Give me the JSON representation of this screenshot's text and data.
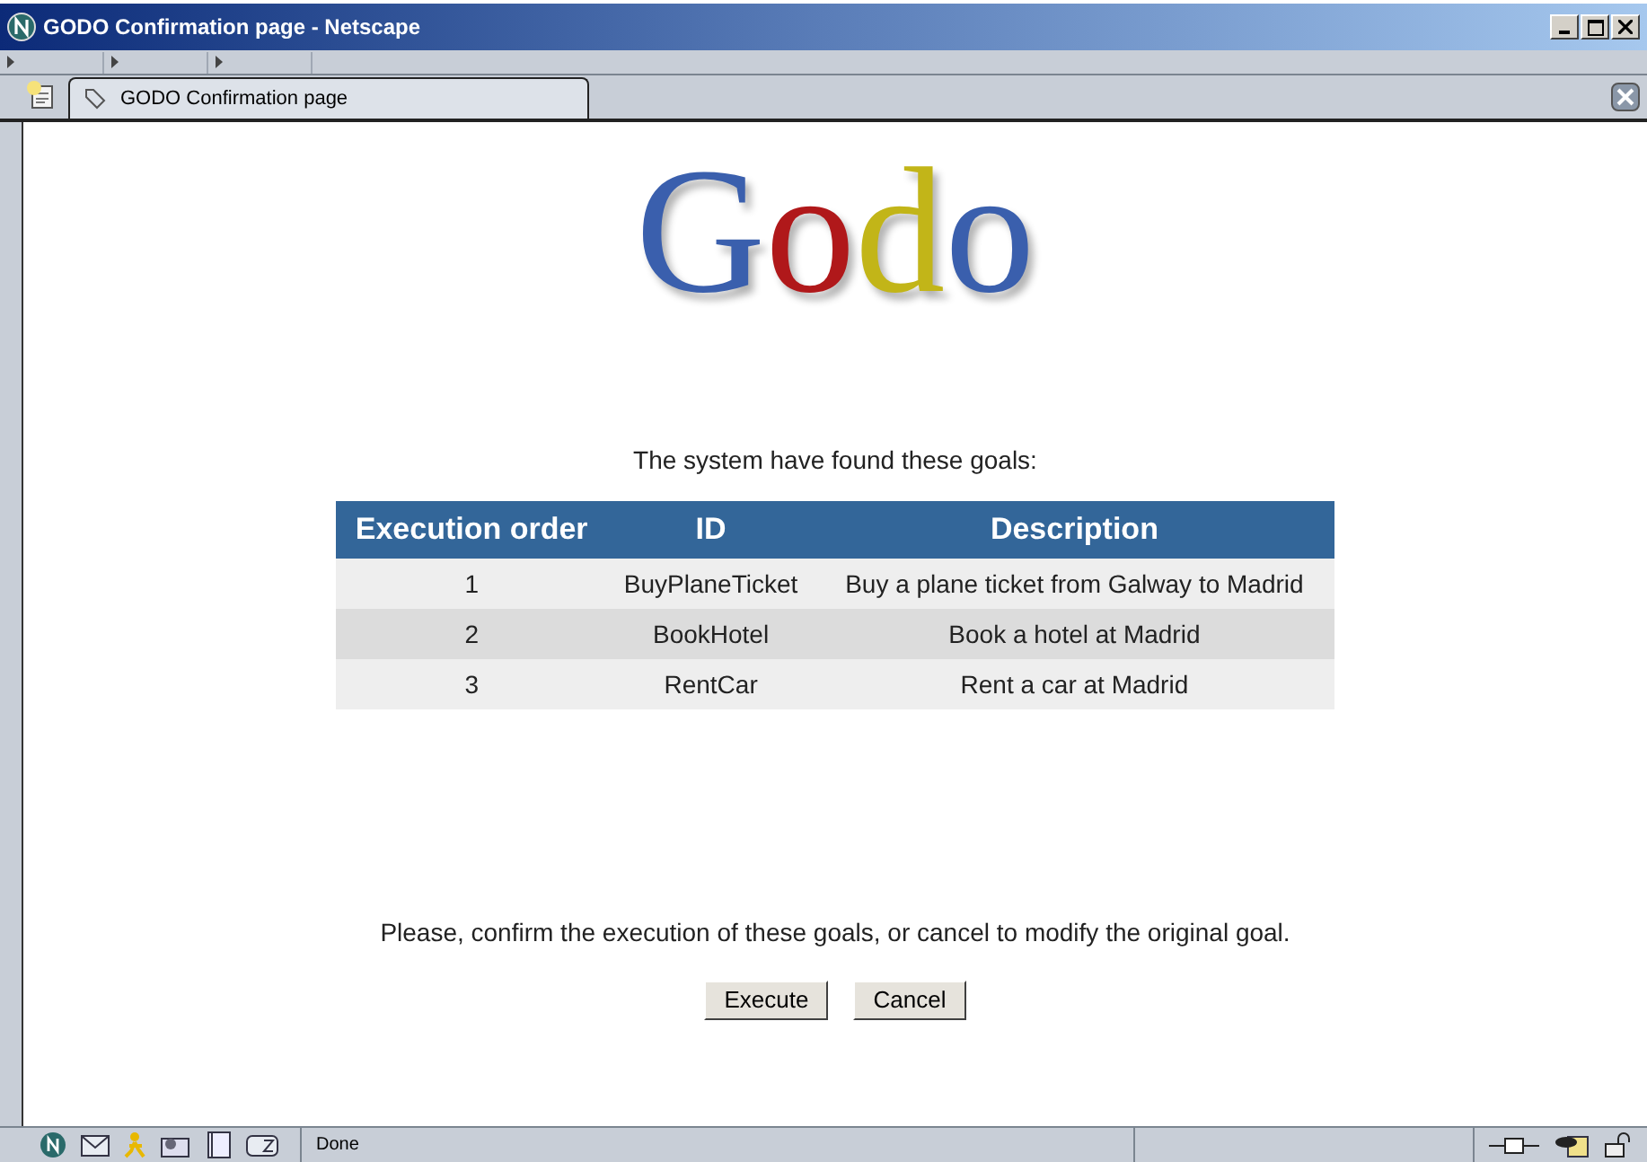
{
  "window": {
    "title": "GODO Confirmation page - Netscape"
  },
  "tabs": [
    {
      "label": "GODO Confirmation page",
      "selected": true
    }
  ],
  "logo": {
    "letters": [
      {
        "text": "G",
        "color": "#3a5fad"
      },
      {
        "text": "o",
        "color": "#b0181a"
      },
      {
        "text": "d",
        "color": "#c2b518"
      },
      {
        "text": "o",
        "color": "#3a5fad"
      }
    ]
  },
  "intro": "The system have found these goals:",
  "table": {
    "columns": [
      "Execution order",
      "ID",
      "Description"
    ],
    "rows": [
      [
        "1",
        "BuyPlaneTicket",
        "Buy a plane ticket from Galway to Madrid"
      ],
      [
        "2",
        "BookHotel",
        "Book a hotel at Madrid"
      ],
      [
        "3",
        "RentCar",
        "Rent a car at Madrid"
      ]
    ]
  },
  "confirm_text": "Please, confirm the execution of these goals, or cancel to modify the original goal.",
  "buttons": [
    "Execute",
    "Cancel"
  ],
  "status_bar": {
    "text": "Done"
  }
}
